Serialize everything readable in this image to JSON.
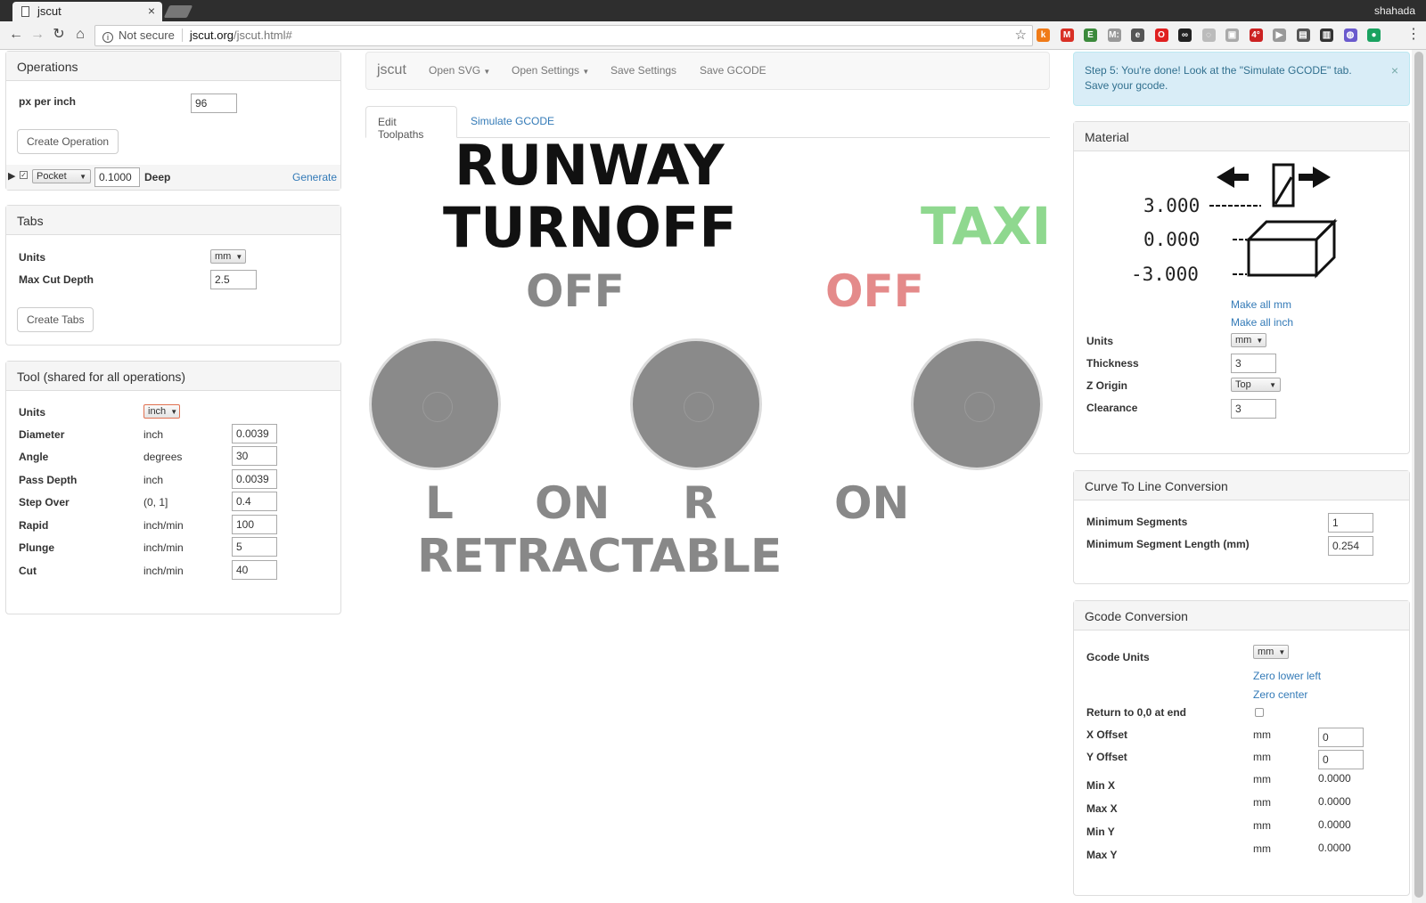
{
  "browser": {
    "tab_title": "jscut",
    "tab_close": "×",
    "user": "shahada",
    "address_security": "Not secure",
    "address_host": "jscut.org",
    "address_path": "/jscut.html#",
    "extensions": [
      {
        "name": "k",
        "color": "#f07b18"
      },
      {
        "name": "M",
        "color": "#d93025"
      },
      {
        "name": "E",
        "color": "#3c8a3c"
      },
      {
        "name": "M:",
        "color": "#999999"
      },
      {
        "name": "e",
        "color": "#555555"
      },
      {
        "name": "O",
        "color": "#e02020"
      },
      {
        "name": "∞",
        "color": "#222222"
      },
      {
        "name": "◌",
        "color": "#bbbbbb"
      },
      {
        "name": "▣",
        "color": "#aaaaaa"
      },
      {
        "name": "4°",
        "color": "#cc2222"
      },
      {
        "name": "▶",
        "color": "#999999"
      },
      {
        "name": "▤",
        "color": "#555555"
      },
      {
        "name": "▥",
        "color": "#333333"
      },
      {
        "name": "◍",
        "color": "#6a5acd"
      },
      {
        "name": "●",
        "color": "#1aa260"
      }
    ]
  },
  "operations": {
    "title": "Operations",
    "px_label": "px per inch",
    "px_value": "96",
    "create_btn": "Create Operation",
    "op_type": "Pocket",
    "op_depth": "0.1000",
    "deep_label": "Deep",
    "generate": "Generate"
  },
  "tabs_panel": {
    "title": "Tabs",
    "units_label": "Units",
    "units_value": "mm",
    "max_cut_label": "Max Cut Depth",
    "max_cut_value": "2.5",
    "create_btn": "Create Tabs"
  },
  "tool": {
    "title": "Tool (shared for all operations)",
    "units_label": "Units",
    "units_value": "inch",
    "rows": [
      {
        "label": "Diameter",
        "unit": "inch",
        "value": "0.0039"
      },
      {
        "label": "Angle",
        "unit": "degrees",
        "value": "30"
      },
      {
        "label": "Pass Depth",
        "unit": "inch",
        "value": "0.0039"
      },
      {
        "label": "Step Over",
        "unit": "(0, 1]",
        "value": "0.4"
      },
      {
        "label": "Rapid",
        "unit": "inch/min",
        "value": "100"
      },
      {
        "label": "Plunge",
        "unit": "inch/min",
        "value": "5"
      },
      {
        "label": "Cut",
        "unit": "inch/min",
        "value": "40"
      }
    ]
  },
  "navbar": {
    "brand": "jscut",
    "open_svg": "Open SVG",
    "open_settings": "Open Settings",
    "save_settings": "Save Settings",
    "save_gcode": "Save GCODE"
  },
  "content_tabs": {
    "edit": "Edit Toolpaths",
    "simulate": "Simulate GCODE"
  },
  "drawing": {
    "runway": "RUNWAY",
    "turnoff": "TURNOFF",
    "taxi": "TAXI",
    "off_left": "OFF",
    "off_right": "OFF",
    "l": "L",
    "on_left": "ON",
    "r": "R",
    "on_right": "ON",
    "retractable": "RETRACTABLE",
    "colors": {
      "black": "#111111",
      "gray": "#888888",
      "green": "#8fd88f",
      "red": "#e48a8a"
    }
  },
  "alert": {
    "text": "Step 5: You're done! Look at the \"Simulate GCODE\" tab. Save your gcode.",
    "close": "×"
  },
  "material": {
    "title": "Material",
    "fig_top": "3.000",
    "fig_mid": "0.000",
    "fig_bot": "-3.000",
    "make_mm": "Make all mm",
    "make_inch": "Make all inch",
    "units_label": "Units",
    "units_value": "mm",
    "thickness_label": "Thickness",
    "thickness_value": "3",
    "zorigin_label": "Z Origin",
    "zorigin_value": "Top",
    "clearance_label": "Clearance",
    "clearance_value": "3"
  },
  "curve": {
    "title": "Curve To Line Conversion",
    "min_seg_label": "Minimum Segments",
    "min_seg_value": "1",
    "min_len_label": "Minimum Segment Length (mm)",
    "min_len_value": "0.254"
  },
  "gcode": {
    "title": "Gcode Conversion",
    "units_label": "Gcode Units",
    "units_value": "mm",
    "zero_lower_left": "Zero lower left",
    "zero_center": "Zero center",
    "return_label": "Return to 0,0 at end",
    "x_offset_label": "X Offset",
    "x_offset_unit": "mm",
    "x_offset_value": "0",
    "y_offset_label": "Y Offset",
    "y_offset_unit": "mm",
    "y_offset_value": "0",
    "bounds": [
      {
        "label": "Min X",
        "unit": "mm",
        "value": "0.0000"
      },
      {
        "label": "Max X",
        "unit": "mm",
        "value": "0.0000"
      },
      {
        "label": "Min Y",
        "unit": "mm",
        "value": "0.0000"
      },
      {
        "label": "Max Y",
        "unit": "mm",
        "value": "0.0000"
      }
    ]
  }
}
